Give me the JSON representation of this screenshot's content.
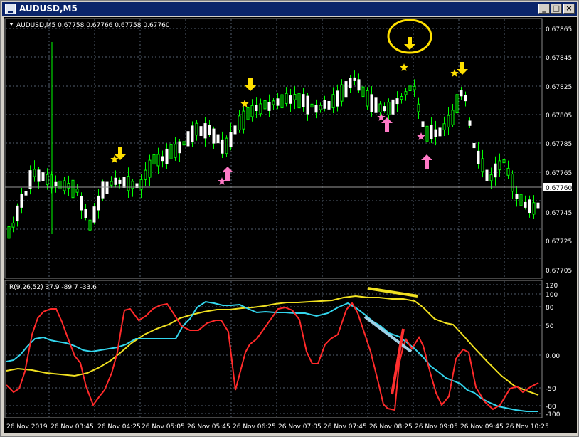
{
  "window": {
    "title": "AUDUSD,M5",
    "buttons": {
      "minimize": "_",
      "maximize": "□",
      "close": "×"
    }
  },
  "price_panel": {
    "info": "AUDUSD,M5  0.67758 0.67766 0.67758 0.67760",
    "price_ticks": [
      "0.67865",
      "0.67845",
      "0.67825",
      "0.67805",
      "0.67785",
      "0.67765",
      "0.67745",
      "0.67725",
      "0.67705"
    ],
    "current_price": "0.67760",
    "colors": {
      "background": "#000000",
      "bull": "#00ff00",
      "bear": "#ffffff",
      "grid": "#556070",
      "down_arrow": "#ffe000",
      "up_arrow": "#ff79c6",
      "circle": "#ffe000"
    }
  },
  "indicator_panel": {
    "info": "R(9,26,52) 37.9 -89.7 -33.6",
    "level_ticks": [
      "120",
      "100",
      "80",
      "50",
      "0.00",
      "-50",
      "-80",
      "-100"
    ],
    "colors": {
      "fast": "#ff2a2a",
      "mid": "#33d6ee",
      "slow": "#f0e020",
      "mark_light": "#9fd0e6",
      "mark_red": "#ff3030"
    }
  },
  "time_axis": {
    "labels": [
      "26 Nov 2019",
      "26 Nov 03:45",
      "26 Nov 04:25",
      "26 Nov 05:05",
      "26 Nov 05:45",
      "26 Nov 06:25",
      "26 Nov 07:05",
      "26 Nov 07:45",
      "26 Nov 08:25",
      "26 Nov 09:05",
      "26 Nov 09:45",
      "26 Nov 10:25"
    ]
  },
  "signals": {
    "down": [
      "down-signal-1",
      "down-signal-2",
      "down-signal-3",
      "down-signal-4"
    ],
    "up": [
      "up-signal-1",
      "up-signal-2",
      "up-signal-3"
    ]
  },
  "chart_data": {
    "type": "candlestick",
    "symbol": "AUDUSD",
    "timeframe": "M5",
    "y_range": [
      0.677,
      0.6787
    ],
    "candles_close_approx": [
      0.6775,
      0.6776,
      0.6778,
      0.6773,
      0.6777,
      0.6775,
      0.6774,
      0.6776,
      0.6775,
      0.6779,
      0.6778,
      0.678,
      0.6781,
      0.6783,
      0.6785,
      0.6782,
      0.6786,
      0.679,
      0.6796,
      0.6799,
      0.68,
      0.6806,
      0.681,
      0.6812,
      0.6818,
      0.6813,
      0.6821,
      0.6823,
      0.6821,
      0.6826,
      0.6823,
      0.6819,
      0.6812,
      0.6815,
      0.6823,
      0.6826,
      0.6829,
      0.6826,
      0.6828,
      0.6819,
      0.6815,
      0.6805,
      0.68,
      0.6798,
      0.6792,
      0.6786,
      0.6778,
      0.6773,
      0.6774,
      0.6775
    ],
    "indicator": {
      "name": "R(9,26,52)",
      "values": [
        37.9,
        -89.7,
        -33.6
      ],
      "y_range": [
        -110,
        125
      ]
    }
  }
}
